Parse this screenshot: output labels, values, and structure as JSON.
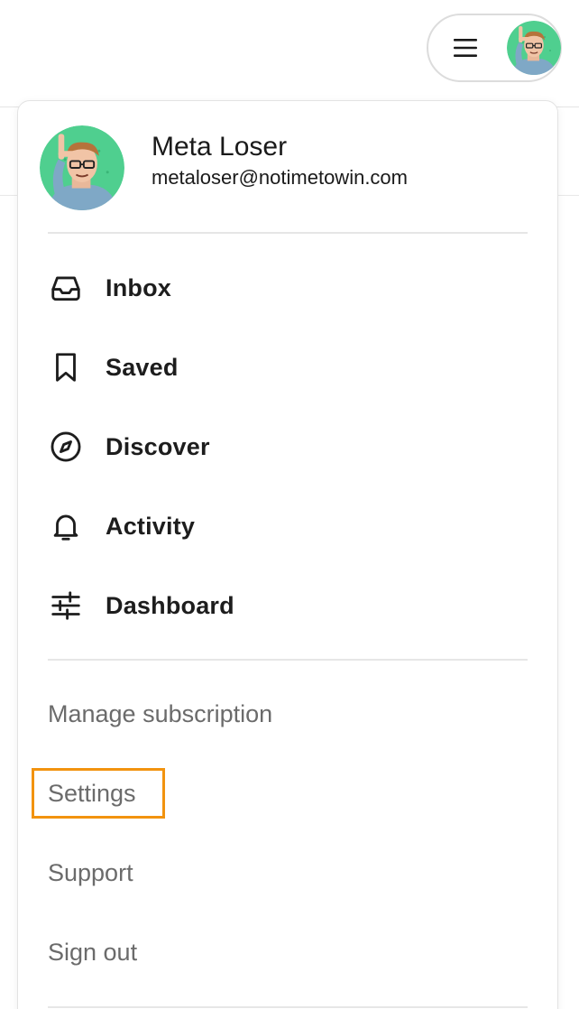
{
  "header": {
    "menu_icon": "hamburger-icon",
    "avatar_icon": "user-avatar"
  },
  "profile": {
    "name": "Meta Loser",
    "email": "metaloser@notimetowin.com"
  },
  "nav": {
    "items": [
      {
        "label": "Inbox",
        "icon": "inbox-icon"
      },
      {
        "label": "Saved",
        "icon": "bookmark-icon"
      },
      {
        "label": "Discover",
        "icon": "compass-icon"
      },
      {
        "label": "Activity",
        "icon": "bell-icon"
      },
      {
        "label": "Dashboard",
        "icon": "sliders-icon"
      }
    ]
  },
  "links": {
    "manage_subscription": "Manage subscription",
    "settings": "Settings",
    "support": "Support",
    "sign_out": "Sign out"
  },
  "colors": {
    "highlight": "#f2930f",
    "avatar_bg": "#4fcf8f"
  }
}
